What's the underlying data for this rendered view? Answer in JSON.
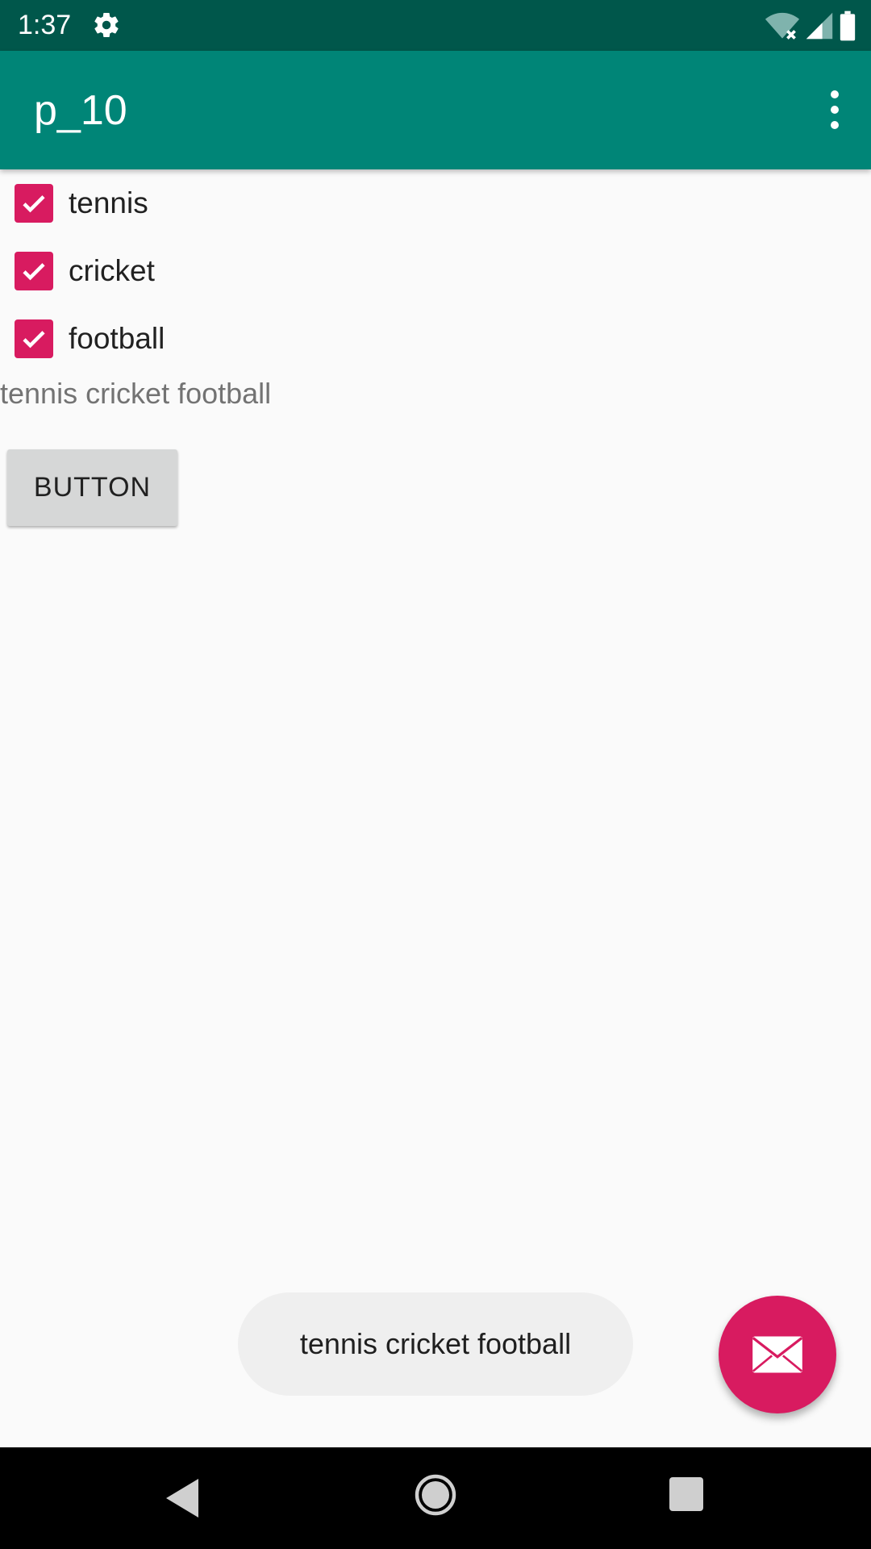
{
  "status_bar": {
    "time": "1:37",
    "icons": [
      "settings-gear-icon",
      "wifi-off-icon",
      "cellular-signal-icon",
      "battery-icon"
    ]
  },
  "app_bar": {
    "title": "p_10",
    "overflow_icon": "more-vert-icon"
  },
  "checkboxes": [
    {
      "label": "tennis",
      "checked": true
    },
    {
      "label": "cricket",
      "checked": true
    },
    {
      "label": "football",
      "checked": true
    }
  ],
  "result_text": "tennis cricket football",
  "button_label": "BUTTON",
  "toast_text": "tennis cricket football",
  "fab_icon": "email-icon",
  "nav_bar": {
    "icons": [
      "back-icon",
      "home-icon",
      "recents-icon"
    ]
  },
  "colors": {
    "status_bar": "#00574b",
    "app_bar": "#008577",
    "accent": "#d81b60",
    "background": "#fafafa"
  }
}
